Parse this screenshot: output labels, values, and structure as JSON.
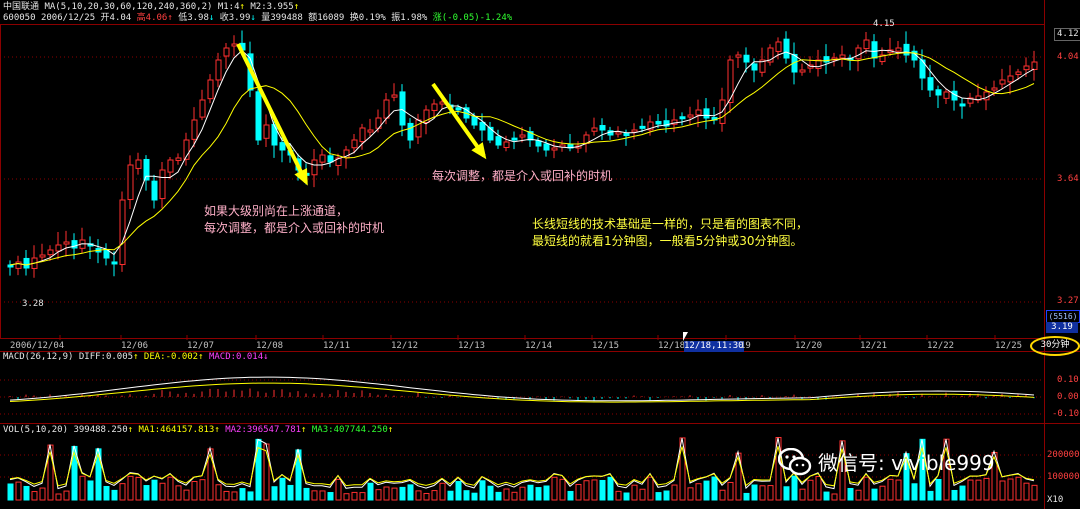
{
  "header": {
    "stock_name": "中国联通",
    "ma_params": "MA(5,10,20,30,60,120,240,360,2)",
    "m1": "M1:4",
    "m2": "M2:3.955",
    "code": "600050",
    "date": "2006/12/25",
    "open": "开4.04",
    "high": "高4.06",
    "low": "低3.98",
    "close": "收3.99",
    "volume": "量399488",
    "amount": "额16089",
    "turnover": "换0.19%",
    "amplitude": "振1.98%",
    "change": "涨(-0.05)-1.24%"
  },
  "price_axis": {
    "labels": [
      "4.12",
      "4.04",
      "3.64",
      "3.27"
    ],
    "pos_box": "(5516)",
    "low_right": "3.19"
  },
  "markers": {
    "high": "4.15",
    "low": "3.28"
  },
  "date_axis": [
    "2006/12/04",
    "12/06",
    "12/07",
    "12/08",
    "12/11",
    "12/12",
    "12/13",
    "12/14",
    "12/15",
    "12/18",
    "12/18,11:30",
    "19",
    "12/20",
    "12/21",
    "12/22",
    "12/25"
  ],
  "period_button": "30分钟",
  "macd": {
    "title": "MACD(26,12,9)",
    "diff": "DIFF:0.005",
    "dea": "DEA:-0.002",
    "macd": "MACD:0.014",
    "axis": [
      "0.10",
      "0.00",
      "-0.10"
    ]
  },
  "vol": {
    "title": "VOL(5,10,20)",
    "value": "399488.250",
    "ma1": "MA1:464157.813",
    "ma2": "MA2:396547.781",
    "ma3": "MA3:407744.250",
    "axis": [
      "200000",
      "100000",
      "X10"
    ]
  },
  "annotations": {
    "a1_line1": "如果大级别尚在上涨通道，",
    "a1_line2": "每次调整，都是介入或回补的时机",
    "a2": "每次调整，都是介入或回补的时机",
    "a3_line1": "长线短线的技术基础是一样的，只是看的图表不同，",
    "a3_line2": "最短线的就看1分钟图，一般看5分钟或30分钟图。"
  },
  "watermark": "微信号: vivible999",
  "colors": {
    "up": "#ff3030",
    "down": "#00ffff",
    "ma_white": "#ffffff",
    "ma_yellow": "#ffff00",
    "grid": "#8b0000",
    "arrow": "#ffff00"
  }
}
